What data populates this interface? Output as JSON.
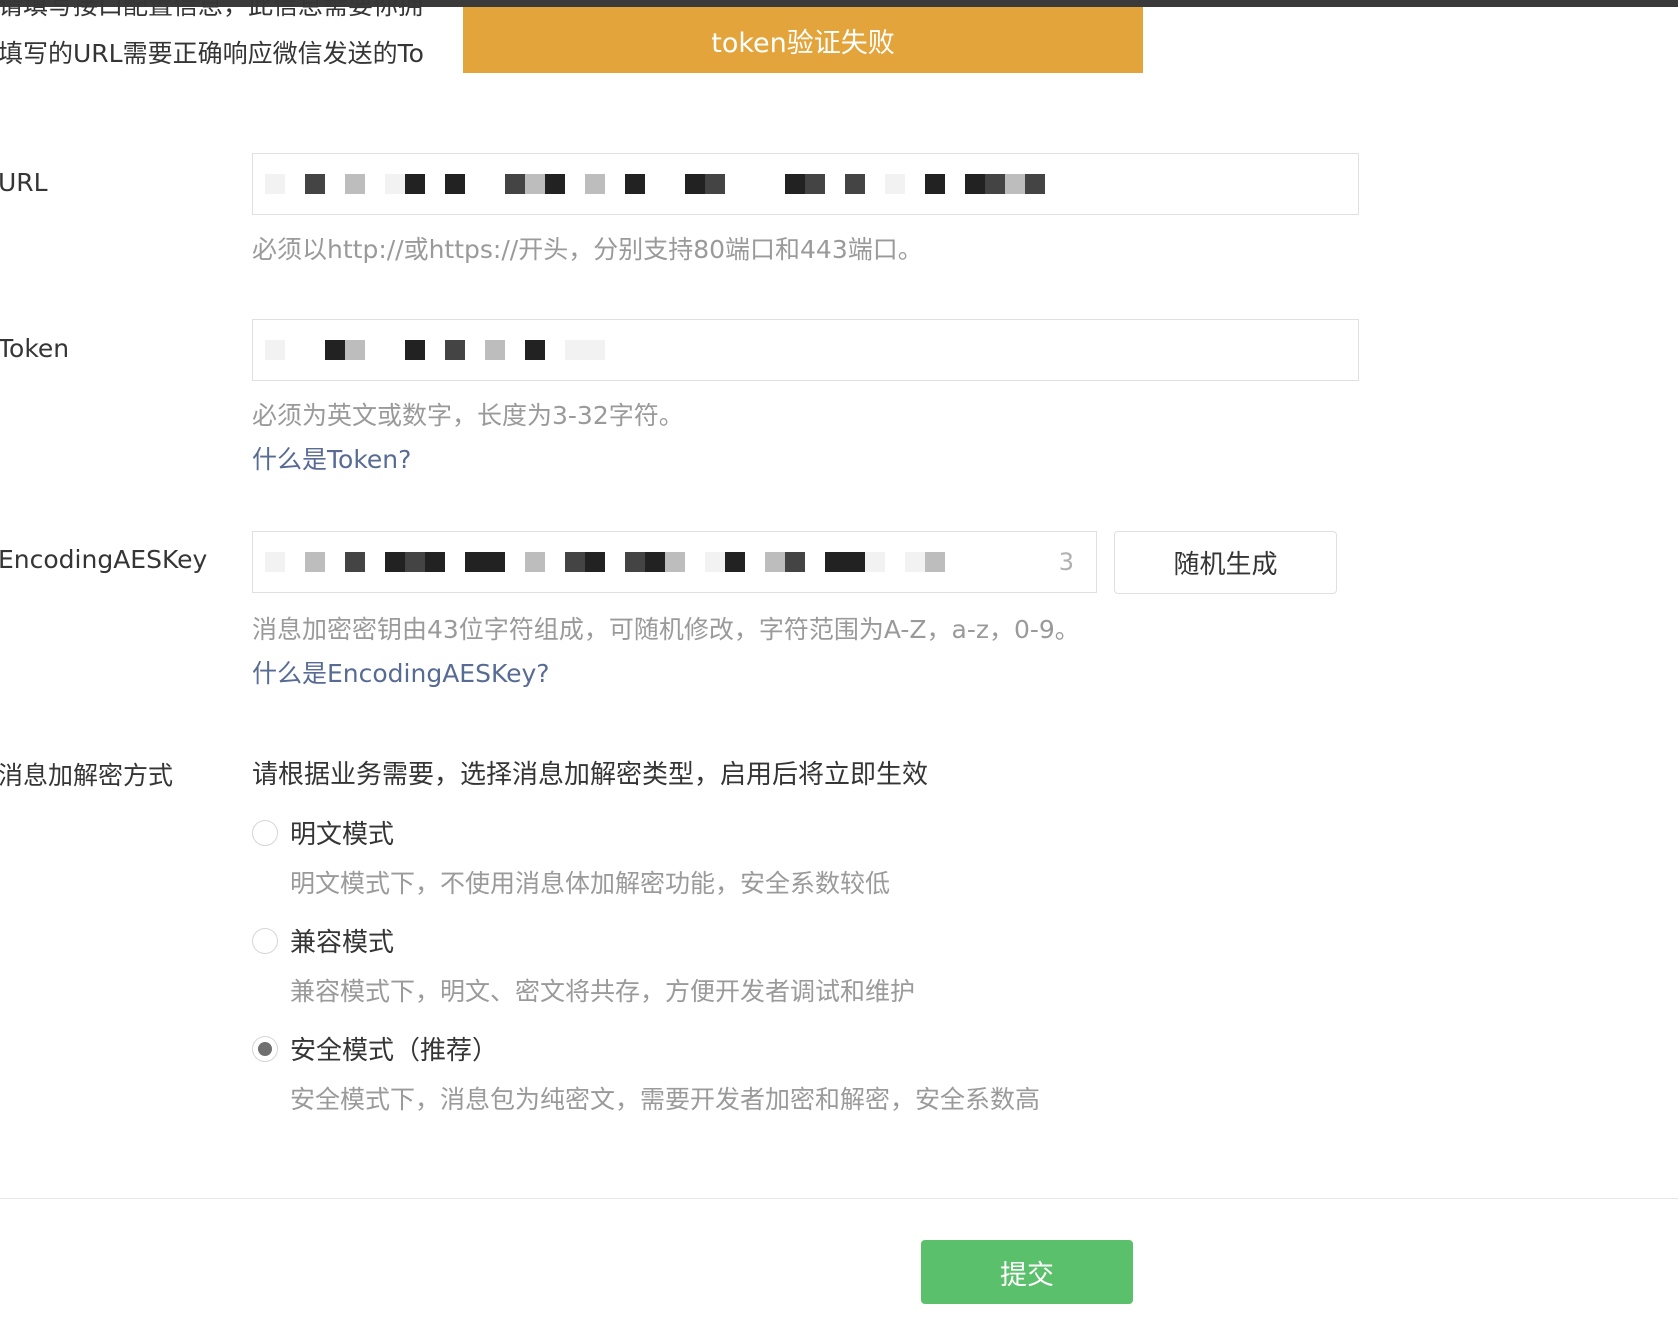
{
  "intro": {
    "line1": "请填写接口配置信息，此信息需要你拥",
    "line2": "填写的URL需要正确响应微信发送的To"
  },
  "toast": {
    "message": "token验证失败"
  },
  "fields": {
    "url": {
      "label": "URL",
      "hint": "必须以http://或https://开头，分别支持80端口和443端口。"
    },
    "token": {
      "label": "Token",
      "hint": "必须为英文或数字，长度为3-32字符。",
      "help_link": "什么是Token?"
    },
    "aeskey": {
      "label": "EncodingAESKey",
      "value_tail": "3",
      "hint": "消息加密密钥由43位字符组成，可随机修改，字符范围为A-Z，a-z，0-9。",
      "help_link": "什么是EncodingAESKey?",
      "random_button": "随机生成"
    }
  },
  "encryption": {
    "label": "消息加解密方式",
    "title": "请根据业务需要，选择消息加解密类型，启用后将立即生效",
    "options": [
      {
        "label": "明文模式",
        "desc": "明文模式下，不使用消息体加解密功能，安全系数较低",
        "selected": false
      },
      {
        "label": "兼容模式",
        "desc": "兼容模式下，明文、密文将共存，方便开发者调试和维护",
        "selected": false
      },
      {
        "label": "安全模式（推荐）",
        "desc": "安全模式下，消息包为纯密文，需要开发者加密和解密，安全系数高",
        "selected": true
      }
    ]
  },
  "submit": {
    "label": "提交"
  },
  "colors": {
    "toast_bg": "#e3a43b",
    "submit_bg": "#5ac06b",
    "link": "#576b95",
    "hint": "#9a9a9a"
  },
  "icons": {
    "radio_unchecked": "radio-unchecked-icon",
    "radio_checked": "radio-checked-icon"
  }
}
